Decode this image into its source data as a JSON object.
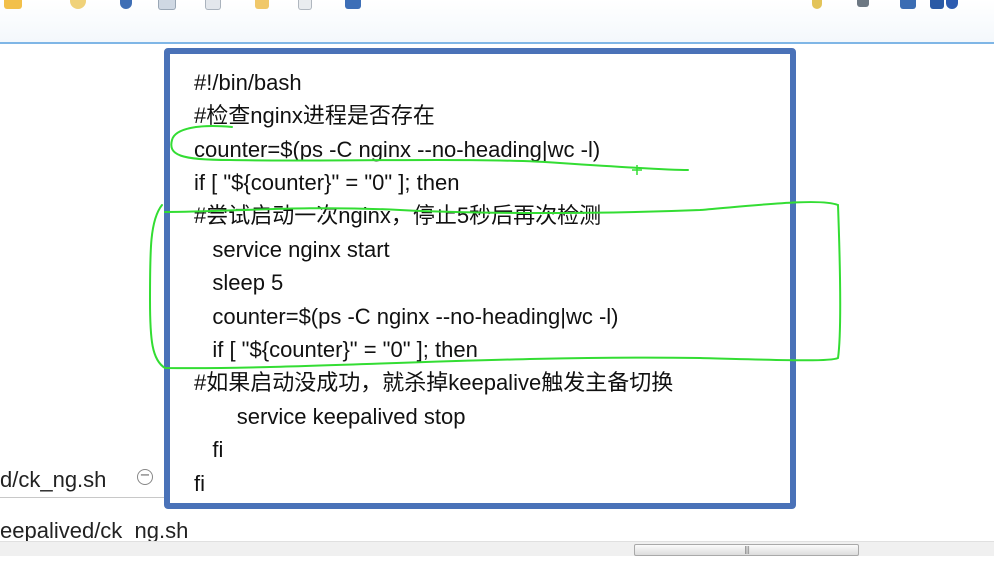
{
  "toolbar": {
    "icons": [
      "folder-icon",
      "chat-icon",
      "undo-icon",
      "document-icon",
      "document-icon",
      "pencil-icon",
      "page-icon",
      "save-icon",
      "bulb-icon",
      "pin-icon",
      "window-icon",
      "terminal-icon",
      "share-icon"
    ]
  },
  "file_tree": {
    "row1": "d/ck_ng.sh",
    "row2": "eepalived/ck_ng.sh",
    "collapse_glyph": "−"
  },
  "scrollbar": {
    "grip": "|||"
  },
  "code": {
    "lines": [
      "#!/bin/bash",
      "#检查nginx进程是否存在",
      "counter=$(ps -C nginx --no-heading|wc -l)",
      "if [ \"${counter}\" = \"0\" ]; then",
      "#尝试启动一次nginx，停止5秒后再次检测",
      "   service nginx start",
      "   sleep 5",
      "   counter=$(ps -C nginx --no-heading|wc -l)",
      "   if [ \"${counter}\" = \"0\" ]; then",
      "#如果启动没成功，就杀掉keepalive触发主备切换",
      "       service keepalived stop",
      "   fi",
      "fi"
    ]
  },
  "colors": {
    "box_border": "#4a72b8",
    "annotation": "#33dd33",
    "toolbar_border": "#7fb6e6"
  }
}
